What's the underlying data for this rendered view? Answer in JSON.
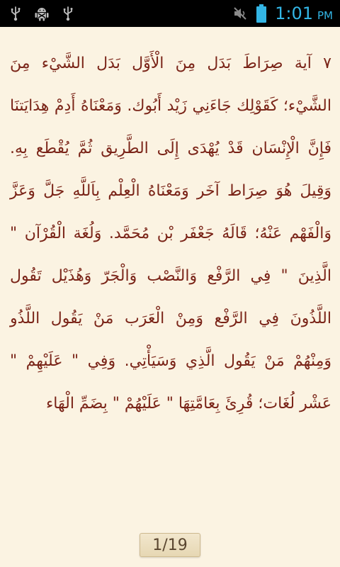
{
  "status_bar": {
    "time": "1:01",
    "ampm": "PM",
    "left_icons": [
      "usb-icon",
      "android-debug-icon",
      "usb-icon"
    ],
    "right_icons": [
      "sound-muted-icon",
      "battery-icon"
    ],
    "clock_color": "#33b5e5"
  },
  "reader": {
    "text": "٧ آية صِرَاطَ بَدَل مِنَ الْأَوَّل بَدَل الشَّيْء مِنَ الشَّيْء؛ كَقَوْلِك جَاءَنِي زَيْد أَبُوك. وَمَعْنَاهُ أَدِمْ هِدَايَتنَا فَإِنَّ الْإِنْسَان قَدْ يُهْدَى إِلَى الطَّرِيق ثُمَّ يُقْطَع بِهِ. وَقِيلَ هُوَ صِرَاط آخَر وَمَعْنَاهُ الْعِلْم بِاَللَّهِ جَلَّ وَعَزَّ وَالْفَهْم عَنْهُ؛ قَالَهُ جَعْفَر بْن مُحَمَّد. وَلُغَة الْقُرْآن \" الَّذِينَ \" فِي الرَّفْع وَالنَّصْب وَالْجَرّ وَهُذَيْل تَقُول اللَّذُونَ فِي الرَّفْع وَمِنْ الْعَرَب مَنْ يَقُول اللَّذُو وَمِنْهُمْ مَنْ يَقُول الَّذِي وَسَيَأْتِي. وَفِي \" عَلَيْهِمْ \" عَشْر لُغَات؛ قُرِئَ بِعَامَّتِهَا \" عَلَيْهُمْ \" بِضَمِّ الْهَاء",
    "text_color": "#7a2418",
    "background": "#fbf3e2"
  },
  "pager": {
    "label": "1/19"
  }
}
